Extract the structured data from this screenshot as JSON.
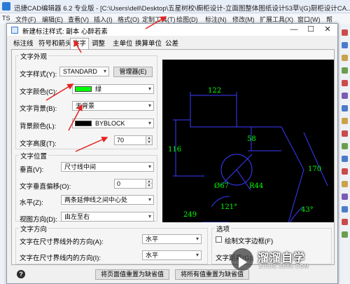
{
  "app": {
    "title": "迅捷CAD编辑器 6.2 专业版 - [C:\\Users\\dell\\Desktop\\五星树校\\橱柜设计-立面图整体图纸设计53草\\(G)厨柜设计CA...",
    "menu": [
      "文件(F)",
      "编辑(E)",
      "查看(V)",
      "插入(I)",
      "格式(O)",
      "定制工具(T)",
      "绘图(D)",
      "标注(N)",
      "修改(M)",
      "扩展工具(X)",
      "窗口(W)",
      "帮"
    ],
    "menu_prefix": "TS"
  },
  "dialog": {
    "title": "新建标注样式: 副本 心醉若素",
    "minimize": "—",
    "maximize": "☐",
    "close": "✕",
    "tabs": [
      "标注线",
      "符号和箭头",
      "文字",
      "调整",
      "主单位",
      "换算单位",
      "公差"
    ],
    "active_tab": "文字"
  },
  "text_appearance": {
    "group_label": "文字外观",
    "style_label": "文字样式(Y):",
    "style_value": "STANDARD",
    "manager_button": "管理器(E)",
    "color_label": "文字颜色(C):",
    "color_value": "绿",
    "color_hex": "#00ff00",
    "bg_label": "文字背景(B):",
    "bg_value": "无背景",
    "bgcolor_label": "背景颜色(L):",
    "bgcolor_value": "BYBLOCK",
    "bgcolor_hex": "#000000",
    "height_label": "文字高度(T):",
    "height_value": "70"
  },
  "text_position": {
    "group_label": "文字位置",
    "vertical_label": "垂直(V):",
    "vertical_value": "尺寸线中间",
    "vertical_offset_label": "文字垂直偏移(O):",
    "vertical_offset_value": "0",
    "horizontal_label": "水平(Z):",
    "horizontal_value": "两条延伸线之间中心处",
    "view_dir_label": "视图方向(D):",
    "view_dir_value": "由左至右"
  },
  "text_direction": {
    "group_label": "文字方向",
    "outside_label": "文字在尺寸界线外的方向(A):",
    "outside_value": "水平",
    "inside_label": "文字在尺寸界线内的方向(I):",
    "inside_value": "水平"
  },
  "options": {
    "group_label": "选项",
    "draw_frame_label": "绘制文字边框(F)",
    "text_distance_label": "文字距离(G):"
  },
  "preview": {
    "dim_top": "122",
    "dim_left": "116",
    "dim_inner": "58",
    "dim_right": "170",
    "diameter": "Ø67",
    "radius": "R44",
    "angle_inner": "121°",
    "angle_right": "43°",
    "dim_bottom": "249",
    "color_hex": "#00ff00",
    "line_hex": "#3b3bff"
  },
  "footer": {
    "help": "?",
    "reset_current": "将页面值重置为缺省值",
    "reset_all": "将所有值重置为缺省值"
  },
  "watermark": {
    "text": "溜溜自学",
    "url": "ZIXUE.3D66.COM"
  }
}
